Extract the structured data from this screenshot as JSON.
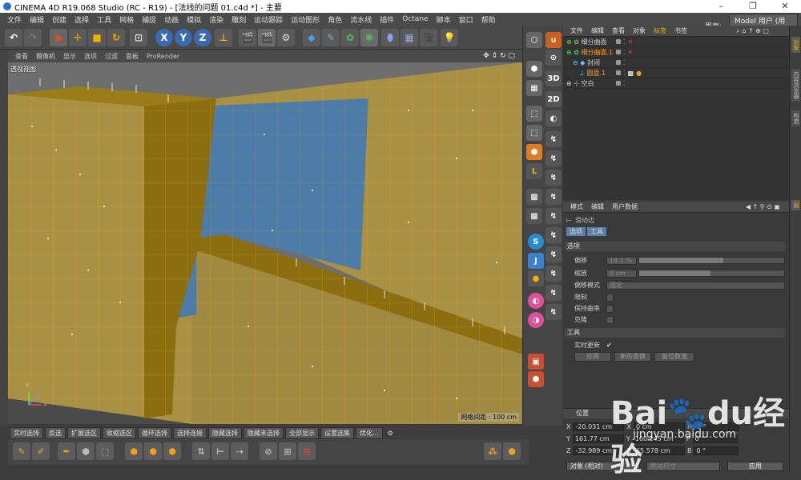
{
  "window": {
    "title": "CINEMA 4D R19.068 Studio (RC - R19) - [法线的问题 01.c4d *] - 主要",
    "minimize": "–",
    "restore": "❐",
    "close": "✕"
  },
  "menu": [
    "文件",
    "编辑",
    "创建",
    "选择",
    "工具",
    "网格",
    "捕捉",
    "动画",
    "模拟",
    "渲染",
    "雕刻",
    "运动跟踪",
    "运动图形",
    "角色",
    "流水线",
    "插件",
    "Octane",
    "脚本",
    "窗口",
    "帮助"
  ],
  "layout": {
    "label": "界面:",
    "value": "Model 用户 (用户)"
  },
  "viewport": {
    "menu": [
      "查看",
      "摄像机",
      "显示",
      "选项",
      "过滤",
      "面板",
      "ProRender"
    ],
    "name": "透视视图",
    "grid_spacing": "网格间距 : 100 cm",
    "axis": {
      "y": "Y",
      "x": "X",
      "z": "Z"
    }
  },
  "objects": {
    "tabs": [
      "文件",
      "编辑",
      "查看",
      "对象",
      "标签",
      "书签"
    ],
    "active_tab": "标签",
    "rows": [
      {
        "name": "细分曲面",
        "color": "#c8c8c8"
      },
      {
        "name": "细分曲面.1",
        "color": "#f0a020"
      },
      {
        "name": "封闭",
        "color": "#c8c8c8"
      },
      {
        "name": "圆盘.1",
        "color": "#f0a020"
      },
      {
        "name": "空白",
        "color": "#c8c8c8"
      }
    ]
  },
  "side_tabs": [
    "对象",
    "内容浏览器",
    "构造",
    "层"
  ],
  "attributes": {
    "tabs": [
      "模式",
      "编辑",
      "用户数据"
    ],
    "tool": "滑动边",
    "subtabs": [
      "选项",
      "工具"
    ],
    "section_options": "选项",
    "offset": {
      "label": "偏移",
      "value": "18.2 %",
      "fraction": 0.58
    },
    "scale": {
      "label": "缩放",
      "value": "0 cm",
      "fraction": 0.49
    },
    "offset_mode": {
      "label": "偏移模式",
      "value": "固定"
    },
    "limit": {
      "label": "限制"
    },
    "keep_curvature": {
      "label": "保持曲率"
    },
    "clone": {
      "label": "克隆"
    },
    "section_tool": "工具",
    "realtime": {
      "label": "实时更新",
      "check": "✔"
    },
    "buttons": [
      "应用",
      "新的变换",
      "复位数值"
    ]
  },
  "coordinates": {
    "header": "位置",
    "x": {
      "label": "X",
      "pos": "-20.031 cm",
      "size": "0 cm",
      "rot": "0 °"
    },
    "y": {
      "label": "Y",
      "pos": "161.77 cm",
      "size": "160.245 cm",
      "rot": "0 °"
    },
    "z": {
      "label": "Z",
      "pos": "-32.989 cm",
      "size": "65.578 cm",
      "rot": "0 °"
    },
    "mode": "对象 (相对)",
    "size_mode": "绝对尺寸",
    "apply": "应用"
  },
  "bottom_tabs": [
    "实时选择",
    "反选",
    "扩展选区",
    "收缩选区",
    "循环选择",
    "选择连接",
    "隐藏选择",
    "隐藏未选择",
    "全部显示",
    "设置选集",
    "优化..."
  ],
  "watermark": {
    "brand": "Bai",
    "paw": "🐾",
    "du": "du",
    "cn": "经验",
    "url": "jingyan.baidu.com"
  }
}
